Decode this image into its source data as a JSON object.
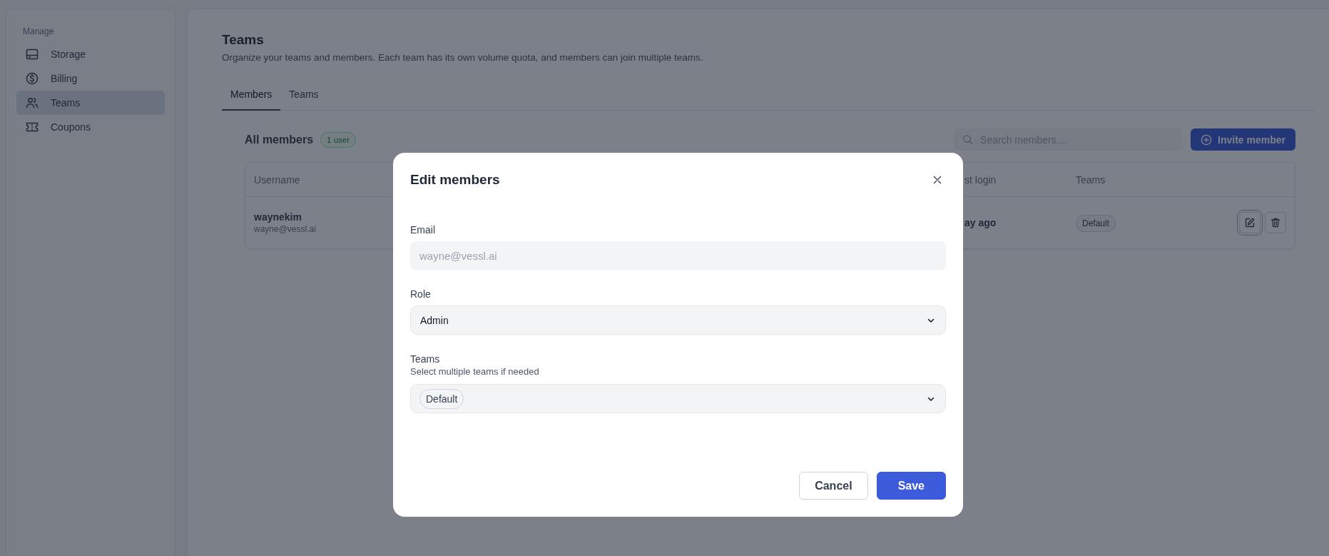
{
  "sidebar": {
    "section": "Manage",
    "items": [
      {
        "label": "Storage",
        "selected": false
      },
      {
        "label": "Billing",
        "selected": false
      },
      {
        "label": "Teams",
        "selected": true
      },
      {
        "label": "Coupons",
        "selected": false
      }
    ]
  },
  "page": {
    "title": "Teams",
    "description": "Organize your teams and members. Each team has its own volume quota, and members can join multiple teams."
  },
  "tabs": [
    {
      "label": "Members",
      "selected": true
    },
    {
      "label": "Teams",
      "selected": false
    }
  ],
  "members": {
    "title": "All members",
    "count": "1 user",
    "search": {
      "placeholder": "Search members...."
    },
    "invite_button": "Invite member",
    "columns": [
      "Username",
      "st login",
      "Teams"
    ],
    "rows": [
      {
        "username": "waynekim",
        "email": "wayne@vessl.ai",
        "last_login": "ay ago",
        "teams": [
          "Default"
        ]
      }
    ]
  },
  "dialog": {
    "title": "Edit members",
    "email": {
      "label": "Email",
      "value": "wayne@vessl.ai",
      "disabled": true
    },
    "role": {
      "label": "Role",
      "value": "Admin"
    },
    "teams": {
      "label": "Teams",
      "hint": "Select multiple teams if needed",
      "chips": [
        "Default"
      ]
    },
    "buttons": {
      "cancel": "Cancel",
      "save": "Save"
    }
  }
}
